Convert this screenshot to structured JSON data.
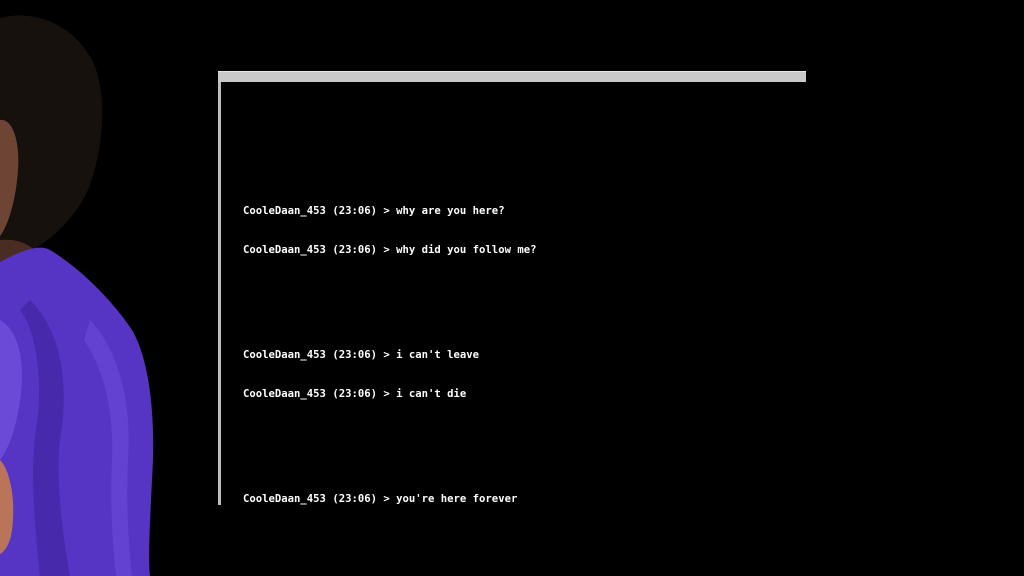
{
  "chat": {
    "groups": [
      {
        "lines": [
          {
            "user": "CooleDaan_453",
            "time": "(23:06)",
            "sep": ">",
            "text": "why are you here?"
          },
          {
            "user": "CooleDaan_453",
            "time": "(23:06)",
            "sep": ">",
            "text": "why did you follow me?"
          }
        ]
      },
      {
        "lines": [
          {
            "user": "CooleDaan_453",
            "time": "(23:06)",
            "sep": ">",
            "text": "i can't leave"
          },
          {
            "user": "CooleDaan_453",
            "time": "(23:06)",
            "sep": ">",
            "text": "i can't die"
          }
        ]
      },
      {
        "lines": [
          {
            "user": "CooleDaan_453",
            "time": "(23:06)",
            "sep": ">",
            "text": "you're here forever"
          }
        ]
      }
    ]
  },
  "colors": {
    "background": "#000000",
    "titlebar": "#c9c9c9",
    "text": "#ffffff",
    "shirt": "#5b36c9",
    "shirt_shadow": "#3a1f8f",
    "hair": "#1a1310",
    "skin": "#8a5a44"
  }
}
